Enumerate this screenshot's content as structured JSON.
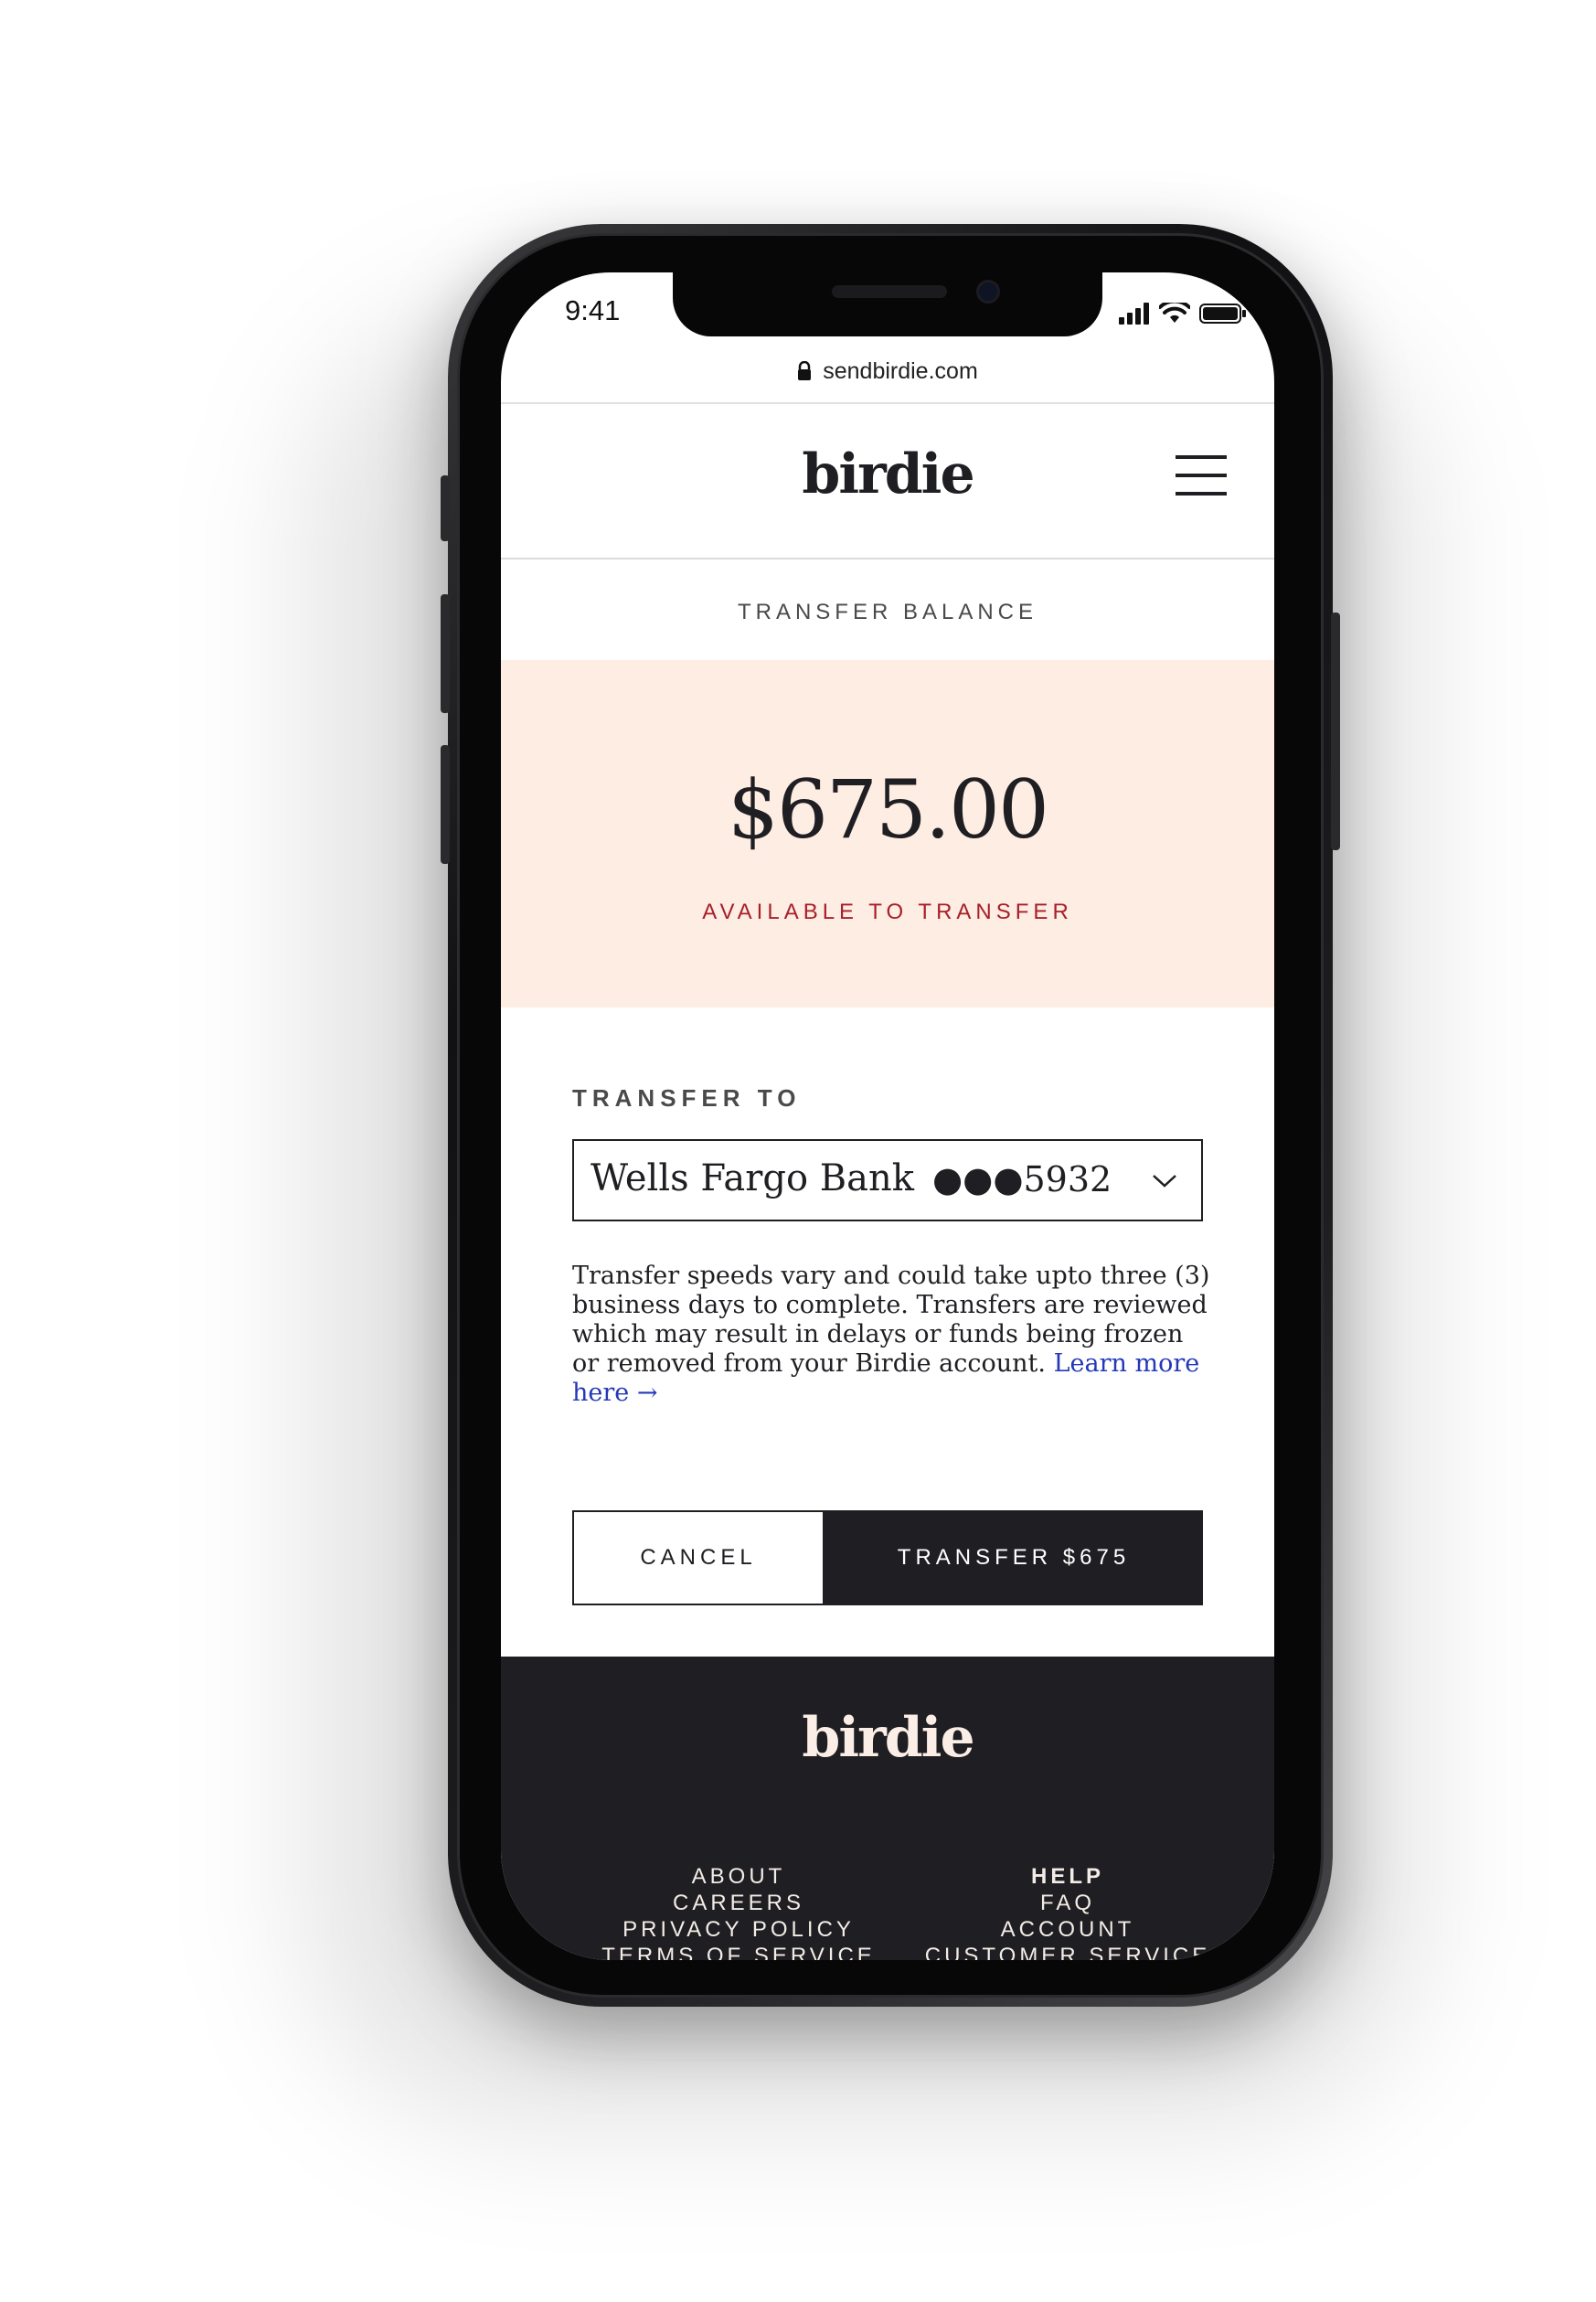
{
  "status_bar": {
    "time": "9:41"
  },
  "browser": {
    "url": "sendbirdie.com"
  },
  "header": {
    "logo": "birdie"
  },
  "page": {
    "title": "TRANSFER BALANCE"
  },
  "balance": {
    "amount": "$675.00",
    "label": "AVAILABLE TO TRANSFER"
  },
  "transfer": {
    "label": "TRANSFER TO",
    "bank_name": "Wells Fargo Bank",
    "account_mask": "●●●5932"
  },
  "notice": {
    "text": "Transfer speeds vary and could take upto three (3) business days to complete. Transfers are reviewed which may result in delays or funds being frozen or removed from your Birdie account. ",
    "link": "Learn more here →"
  },
  "actions": {
    "cancel": "CANCEL",
    "transfer": "TRANSFER $675"
  },
  "footer": {
    "logo": "birdie",
    "left_links": [
      "ABOUT",
      "CAREERS",
      "PRIVACY POLICY",
      "TERMS OF SERVICE"
    ],
    "right_links": [
      "HELP",
      "FAQ",
      "ACCOUNT",
      "CUSTOMER SERVICE"
    ]
  },
  "colors": {
    "ink": "#1f1e22",
    "balance_panel": "#fdede3",
    "alert_red": "#a8202a",
    "link_blue": "#2438b8"
  },
  "icons": [
    "lock-icon",
    "signal-icon",
    "wifi-icon",
    "battery-icon",
    "menu-icon",
    "chevron-down-icon"
  ]
}
